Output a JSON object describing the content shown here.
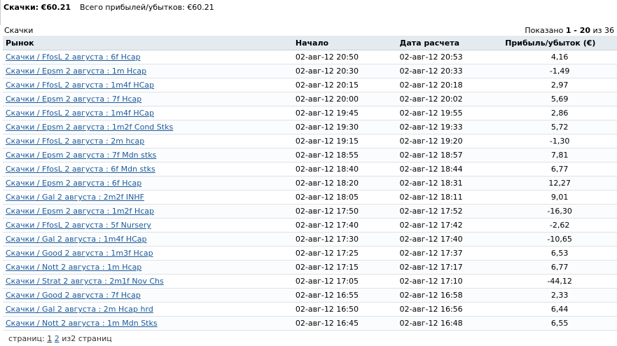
{
  "summary": {
    "label": "Скачки:",
    "amount": "€60.21",
    "total_label": "Всего прибылей/убытков:",
    "total_amount": "€60.21"
  },
  "section_label": "Скачки",
  "shown": {
    "prefix": "Показано",
    "range": "1 - 20",
    "mid": "из",
    "total": "36"
  },
  "columns": {
    "market": "Рынок",
    "start": "Начало",
    "settled": "Дата расчета",
    "pl": "Прибыль/убыток (€)"
  },
  "rows": [
    {
      "market": "Скачки / FfosL 2 августа : 6f Hcap",
      "start": "02-авг-12 20:50",
      "settled": "02-авг-12 20:53",
      "pl": "4,16"
    },
    {
      "market": "Скачки / Epsm 2 августа : 1m Hcap",
      "start": "02-авг-12 20:30",
      "settled": "02-авг-12 20:33",
      "pl": "-1,49"
    },
    {
      "market": "Скачки / FfosL 2 августа : 1m4f HCap",
      "start": "02-авг-12 20:15",
      "settled": "02-авг-12 20:18",
      "pl": "2,97"
    },
    {
      "market": "Скачки / Epsm 2 августа : 7f Hcap",
      "start": "02-авг-12 20:00",
      "settled": "02-авг-12 20:02",
      "pl": "5,69"
    },
    {
      "market": "Скачки / FfosL 2 августа : 1m4f HCap",
      "start": "02-авг-12 19:45",
      "settled": "02-авг-12 19:55",
      "pl": "2,86"
    },
    {
      "market": "Скачки / Epsm 2 августа : 1m2f Cond Stks",
      "start": "02-авг-12 19:30",
      "settled": "02-авг-12 19:33",
      "pl": "5,72"
    },
    {
      "market": "Скачки / FfosL 2 августа : 2m hcap",
      "start": "02-авг-12 19:15",
      "settled": "02-авг-12 19:20",
      "pl": "-1,30"
    },
    {
      "market": "Скачки / Epsm 2 августа : 7f Mdn stks",
      "start": "02-авг-12 18:55",
      "settled": "02-авг-12 18:57",
      "pl": "7,81"
    },
    {
      "market": "Скачки / FfosL 2 августа : 6f Mdn stks",
      "start": "02-авг-12 18:40",
      "settled": "02-авг-12 18:44",
      "pl": "6,77"
    },
    {
      "market": "Скачки / Epsm 2 августа : 6f Hcap",
      "start": "02-авг-12 18:20",
      "settled": "02-авг-12 18:31",
      "pl": "12,27"
    },
    {
      "market": "Скачки / Gal 2 августа : 2m2f INHF",
      "start": "02-авг-12 18:05",
      "settled": "02-авг-12 18:11",
      "pl": "9,01"
    },
    {
      "market": "Скачки / Epsm 2 августа : 1m2f Hcap",
      "start": "02-авг-12 17:50",
      "settled": "02-авг-12 17:52",
      "pl": "-16,30"
    },
    {
      "market": "Скачки / FfosL 2 августа : 5f Nursery",
      "start": "02-авг-12 17:40",
      "settled": "02-авг-12 17:42",
      "pl": "-2,62"
    },
    {
      "market": "Скачки / Gal 2 августа : 1m4f HCap",
      "start": "02-авг-12 17:30",
      "settled": "02-авг-12 17:40",
      "pl": "-10,65"
    },
    {
      "market": "Скачки / Good 2 августа : 1m3f Hcap",
      "start": "02-авг-12 17:25",
      "settled": "02-авг-12 17:37",
      "pl": "6,53"
    },
    {
      "market": "Скачки / Nott 2 августа : 1m Hcap",
      "start": "02-авг-12 17:15",
      "settled": "02-авг-12 17:17",
      "pl": "6,77"
    },
    {
      "market": "Скачки / Strat 2 августа : 2m1f Nov Chs",
      "start": "02-авг-12 17:05",
      "settled": "02-авг-12 17:10",
      "pl": "-44,12"
    },
    {
      "market": "Скачки / Good 2 августа : 7f Hcap",
      "start": "02-авг-12 16:55",
      "settled": "02-авг-12 16:58",
      "pl": "2,33"
    },
    {
      "market": "Скачки / Gal 2 августа : 2m Hcap hrd",
      "start": "02-авг-12 16:50",
      "settled": "02-авг-12 16:56",
      "pl": "6,44"
    },
    {
      "market": "Скачки / Nott 2 августа : 1m Mdn Stks",
      "start": "02-авг-12 16:45",
      "settled": "02-авг-12 16:48",
      "pl": "6,55"
    }
  ],
  "pager": {
    "label": "страниц:",
    "current": "1",
    "next": "2",
    "suffix": "из2 страниц"
  }
}
